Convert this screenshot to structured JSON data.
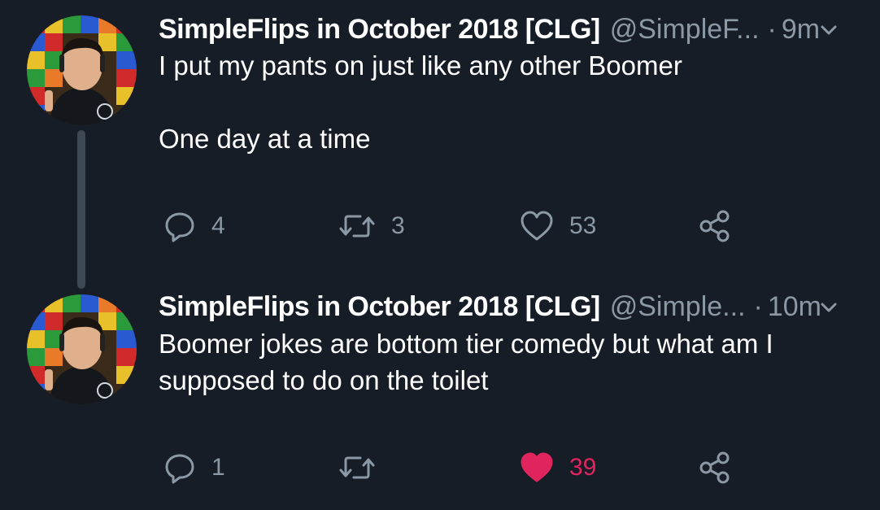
{
  "tweets": [
    {
      "display_name": "SimpleFlips in October 2018 [CLG]",
      "handle": "@SimpleF...",
      "separator": "·",
      "time": "9m",
      "text_line1": "I put my pants on just like any other Boomer",
      "text_line2": "One day at a time",
      "reply_count": "4",
      "retweet_count": "3",
      "like_count": "53",
      "liked": false
    },
    {
      "display_name": "SimpleFlips in October 2018 [CLG]",
      "handle": "@Simple...",
      "separator": "·",
      "time": "10m",
      "text_line1": "Boomer jokes are bottom tier comedy but what am I",
      "text_line2": "supposed to do on the toilet",
      "reply_count": "1",
      "retweet_count": "",
      "like_count": "39",
      "liked": true
    }
  ],
  "colors": {
    "background": "#161d26",
    "secondary_text": "#8b98a5",
    "like_active": "#e0245e",
    "thread_line": "#3c4853"
  },
  "icons": [
    "reply-icon",
    "retweet-icon",
    "like-icon",
    "share-icon",
    "chevron-down-icon"
  ]
}
